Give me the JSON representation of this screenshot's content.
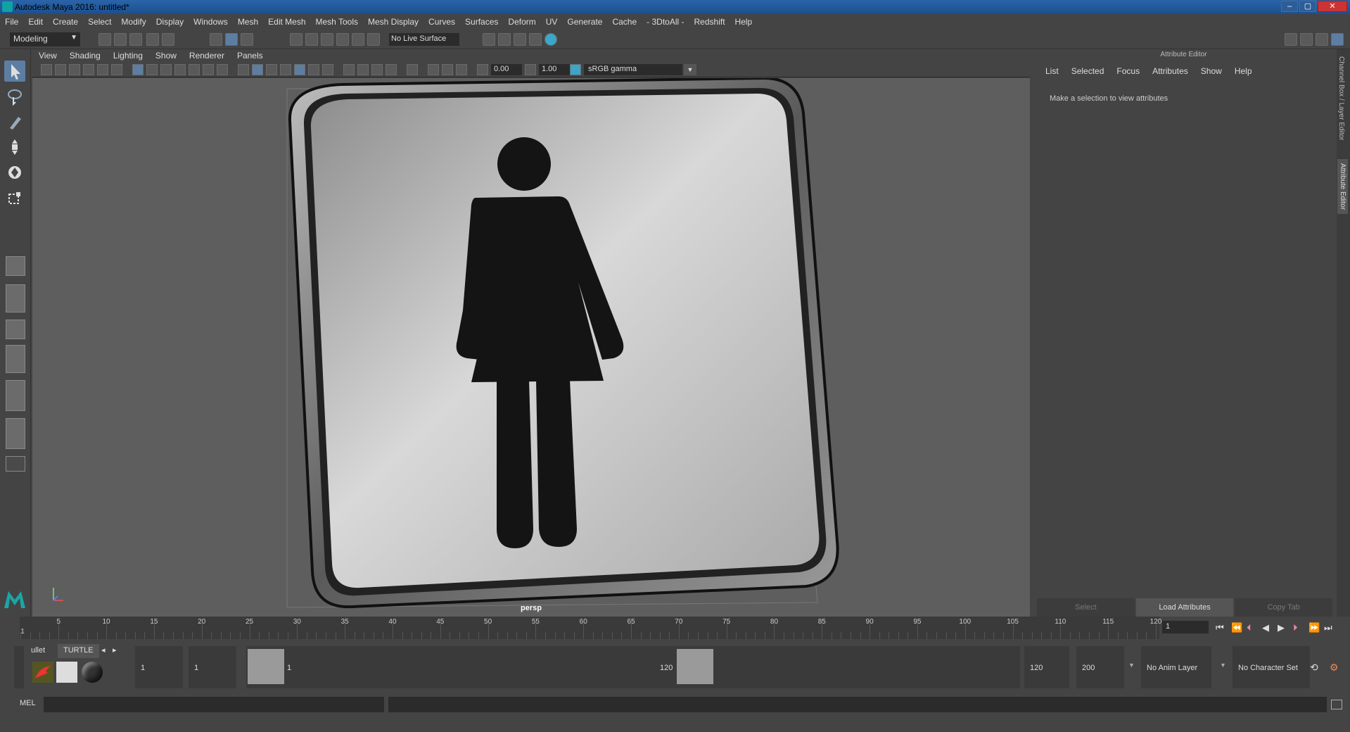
{
  "window": {
    "title": "Autodesk Maya 2016: untitled*",
    "buttons": [
      "–",
      "▢",
      "✕"
    ]
  },
  "menu": [
    "File",
    "Edit",
    "Create",
    "Select",
    "Modify",
    "Display",
    "Windows",
    "Mesh",
    "Edit Mesh",
    "Mesh Tools",
    "Mesh Display",
    "Curves",
    "Surfaces",
    "Deform",
    "UV",
    "Generate",
    "Cache",
    "- 3DtoAll -",
    "Redshift",
    "Help"
  ],
  "shelf": {
    "mode": "Modeling",
    "live_surface": "No Live Surface"
  },
  "viewport": {
    "menu": [
      "View",
      "Shading",
      "Lighting",
      "Show",
      "Renderer",
      "Panels"
    ],
    "exposure": "0.00",
    "gamma": "1.00",
    "colorspace": "sRGB gamma",
    "camera": "persp"
  },
  "attribute_editor": {
    "title": "Attribute Editor",
    "tabs": [
      "List",
      "Selected",
      "Focus",
      "Attributes",
      "Show",
      "Help"
    ],
    "message": "Make a selection to view attributes",
    "buttons": [
      "Select",
      "Load Attributes",
      "Copy Tab"
    ]
  },
  "side_tabs": [
    "Channel Box / Layer Editor",
    "Attribute Editor"
  ],
  "timeline": {
    "labels": [
      "1",
      "5",
      "10",
      "15",
      "20",
      "25",
      "30",
      "35",
      "40",
      "45",
      "50",
      "55",
      "60",
      "65",
      "70",
      "75",
      "80",
      "85",
      "90",
      "95",
      "100",
      "105",
      "110",
      "115",
      "120"
    ],
    "current_frame": "1"
  },
  "range": {
    "shelf_tabs": [
      "ullet",
      "TURTLE"
    ],
    "start": "1",
    "playback_start": "1",
    "slider_start_label": "1",
    "slider_end_label": "120",
    "playback_end": "120",
    "end": "200",
    "anim_layer": "No Anim Layer",
    "character_set": "No Character Set"
  },
  "command_line": {
    "label": "MEL"
  }
}
